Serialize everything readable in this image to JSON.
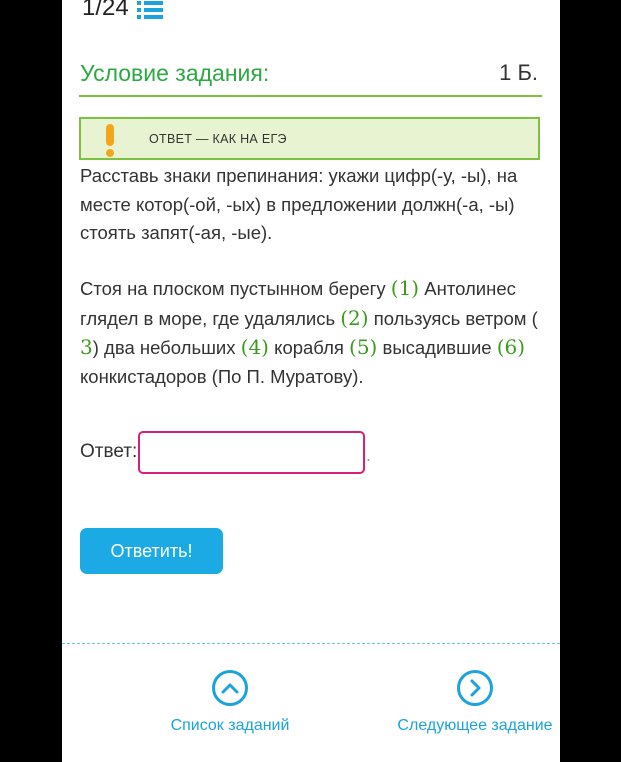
{
  "header": {
    "counter": "1/24",
    "title": "Условие задания:",
    "points": "1 Б."
  },
  "alert": {
    "text": "ОТВЕТ — КАК НА ЕГЭ",
    "icon": "exclamation-icon"
  },
  "task": {
    "instruction": "Расставь знаки препинания: укажи цифр(-у, -ы), на месте котор(-ой, -ых) в предложении должн(-а, -ы) стоять запят(-ая, -ые).",
    "sentence": [
      "Стоя на плоском пустынном берегу ",
      "(1)",
      " Антолинес глядел в море, где удалялись ",
      "(2)",
      " пользуясь ветром ( ",
      "3",
      ") два небольших ",
      "(4)",
      " корабля ",
      "(5)",
      " высадившие ",
      "(6)",
      " конкистадоров (По П. Муратову)."
    ]
  },
  "answer": {
    "label": "Ответ:",
    "value": "",
    "dot": "."
  },
  "submit_label": "Ответить!",
  "nav": {
    "list_label": "Список заданий",
    "next_label": "Следующее задание"
  },
  "colors": {
    "accent_green": "#7dc142",
    "title_green": "#2da843",
    "blue": "#1ba3dd",
    "input_border": "#d6207a"
  }
}
